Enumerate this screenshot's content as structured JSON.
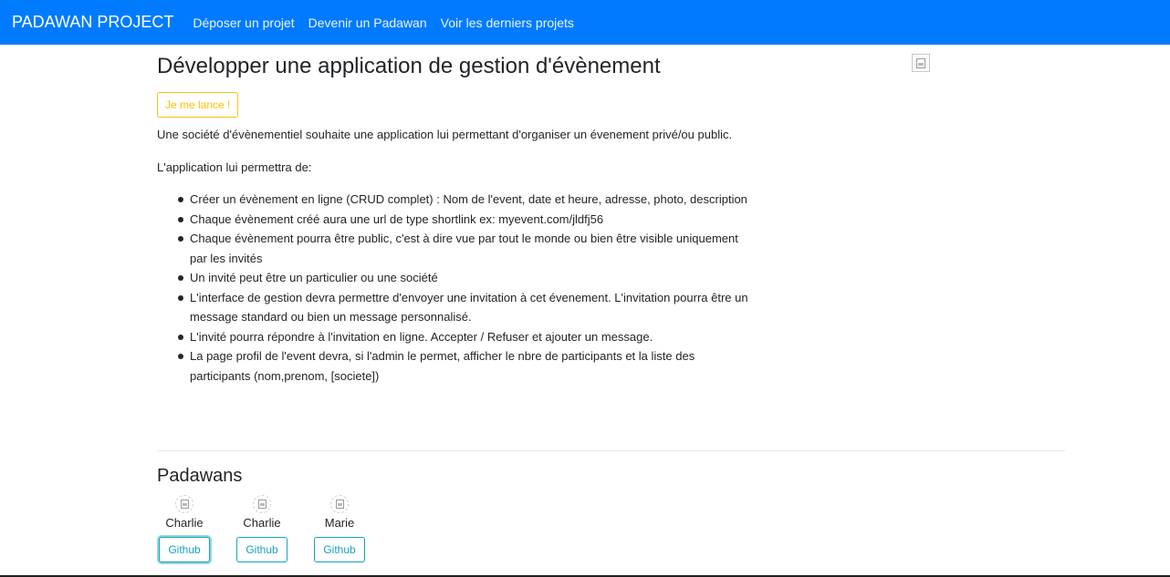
{
  "navbar": {
    "brand": "PADAWAN PROJECT",
    "links": [
      "Déposer un projet",
      "Devenir un Padawan",
      "Voir les derniers projets"
    ]
  },
  "project": {
    "title": "Développer une application de gestion d'évènement",
    "cta_label": "Je me lance !",
    "intro": "Une société d'évènementiel souhaite une application lui permettant d'organiser un évenement privé/ou public.",
    "features_intro": "L'application lui permettra de:",
    "features": [
      "Créer un évènement en ligne (CRUD complet) : Nom de l'event, date et heure, adresse, photo, description",
      "Chaque évènement créé aura une url de type shortlink ex: myevent.com/jldfj56",
      "Chaque évènement pourra être public, c'est à dire vue par tout le monde ou bien être visible uniquement par les invités",
      "Un invité peut être un particulier ou une société",
      "L'interface de gestion devra permettre d'envoyer une invitation à cet évenement. L'invitation pourra être un message standard ou bien un message personnalisé.",
      "L'invité pourra répondre à l'invitation en ligne. Accepter / Refuser et ajouter un message.",
      "La page profil de l'event devra, si l'admin le permet, afficher le nbre de participants et la liste des participants (nom,prenom, [societe])"
    ]
  },
  "padawans_section": {
    "title": "Padawans",
    "button_label": "Github",
    "members": [
      {
        "name": "Charlie"
      },
      {
        "name": "Charlie"
      },
      {
        "name": "Marie"
      }
    ]
  },
  "colors": {
    "navbar": "#007bff",
    "warning": "#ffc107",
    "info": "#17a2b8"
  }
}
